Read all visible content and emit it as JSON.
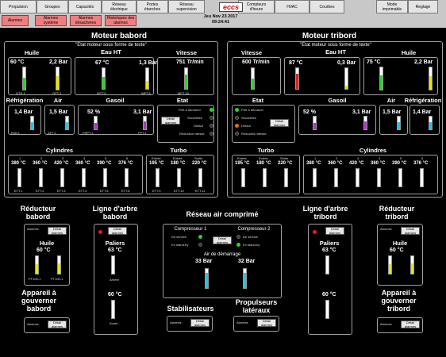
{
  "nav": [
    "Propulsion",
    "Groupes",
    "Capacités",
    "Réseau électrique",
    "Portes étanches",
    "Réseau supervision",
    "Compteurs d'heure",
    "HVAC",
    "Courbes",
    "Mode imprimable",
    "Reglage"
  ],
  "sub": [
    "Alarmes",
    "Alarmes système",
    "Alarmes désactivées",
    "Historiques des alarmes"
  ],
  "logo": "eccs",
  "date": "Jeu Nov 23 2017",
  "time": "09:24:41",
  "colors": {
    "green": "#2fd12f",
    "yellow": "#e8e800",
    "cyan": "#21c4e8",
    "purple": "#b030d0",
    "red": "#e02020",
    "orange": "#e07010",
    "alarm": "#ef7f7f"
  },
  "left": {
    "title": "Moteur babord",
    "subtitle": "\"Etat moteur sous forme de texte\"",
    "mode": "Eau HT",
    "huile": "Huile",
    "huile_t": "60 °C",
    "huile_p": "2,2 Bar",
    "huile_tags": [
      "OTH.1",
      "OPT.2"
    ],
    "eauht_t": "67 °C",
    "eauht_p": "1,3 Bar",
    "eauht_tags": [
      "WTT.6",
      "WPT.6"
    ],
    "vitesse": "Vitesse",
    "vit_val": "751 Tr/min",
    "vit_tag": "MPT.1A",
    "refrig": "Réfrigération",
    "refrig_val": "1,4 Bar",
    "refrig_tag": "EMI.6",
    "air": "Air",
    "air_val": "1,5 Bar",
    "air_tag": "APT.2",
    "gasoil": "Gasoil",
    "gas_t": "52 %",
    "gas_p": "3,1 Bar",
    "gas_tags": [
      "FRPT.1",
      "FPT.1"
    ],
    "etat": "Etat",
    "etat_items": [
      "Prêt à démarrer",
      "Sécuritées",
      "Défaut",
      "Réduction vitesse"
    ],
    "detail": "Détail alarmes",
    "cyl_title": "Cylindres",
    "cyl_nums": [
      "1",
      "2",
      "3",
      "4",
      "5",
      "6"
    ],
    "cyl_temps": [
      "380 °C",
      "360 °C",
      "420 °C",
      "360 °C",
      "390 °C",
      "376 °C"
    ],
    "cyl_tags": [
      "ETT.1",
      "ETT.2",
      "ETT.3",
      "ETT.4",
      "ETT.5",
      "ETT.6"
    ],
    "turbo_title": "Turbo",
    "turbo_lbl": [
      "Entrée",
      "Entrée",
      "Sortie"
    ],
    "turbo_vals": [
      "195 °C",
      "180 °C",
      "220 °C"
    ],
    "turbo_tags": [
      "ETT.9",
      "ETT.10",
      "ETT.11"
    ]
  },
  "right": {
    "title": "Moteur tribord",
    "subtitle": "\"Etat moteur sous forme de texte\"",
    "mode": "Eau HT",
    "vitesse": "Vitesse",
    "vit_val": "600 Tr/min",
    "eauht_t": "87 °C",
    "eauht_p": "0,3 Bar",
    "huile": "Huile",
    "huile_t": "75 °C",
    "huile_p": "2,2 Bar",
    "etat": "Etat",
    "gasoil": "Gasoil",
    "air": "Air",
    "refrig": "Réfrigération",
    "gas_t": "52 %",
    "gas_p": "3,1 Bar",
    "air_val": "1,5 Bar",
    "refrig_val": "1,4 Bar",
    "cyl_title": "Cylindres",
    "turbo_title": "Turbo",
    "cyl_temps": [
      "380 °C",
      "360 °C",
      "420 °C",
      "360 °C",
      "390 °C",
      "376 °C"
    ],
    "turbo_vals": [
      "195 °C",
      "180 °C",
      "220 °C"
    ]
  },
  "bottom": {
    "red_bab": "Réducteur babord",
    "ligne_bab": "Ligne d'arbre babord",
    "reseau_air": "Réseau air comprimé",
    "ligne_tri": "Ligne d'arbre tribord",
    "red_tri": "Réducteur tribord",
    "alarmes": "Alarmes",
    "detail": "Détail alarmes",
    "huile": "Huile",
    "paliers": "Paliers",
    "t60": "60 °C",
    "t63": "63 °C",
    "tags_red": [
      "PT100-1",
      "PT100-1"
    ],
    "arriere": "Arrière",
    "avant": "Avant",
    "comp1": "Compresseur 1",
    "comp2": "Compresseur 2",
    "service": "De service",
    "standby": "En stand-by",
    "demarrage": "Air de démarrage",
    "p33": "33 Bar",
    "p32": "32 Bar",
    "appareil_bab": "Appareil à gouverner babord",
    "appareil_tri": "Appareil à gouverner tribord",
    "stabil": "Stabilisateurs",
    "propul": "Propulseurs latéraux"
  }
}
